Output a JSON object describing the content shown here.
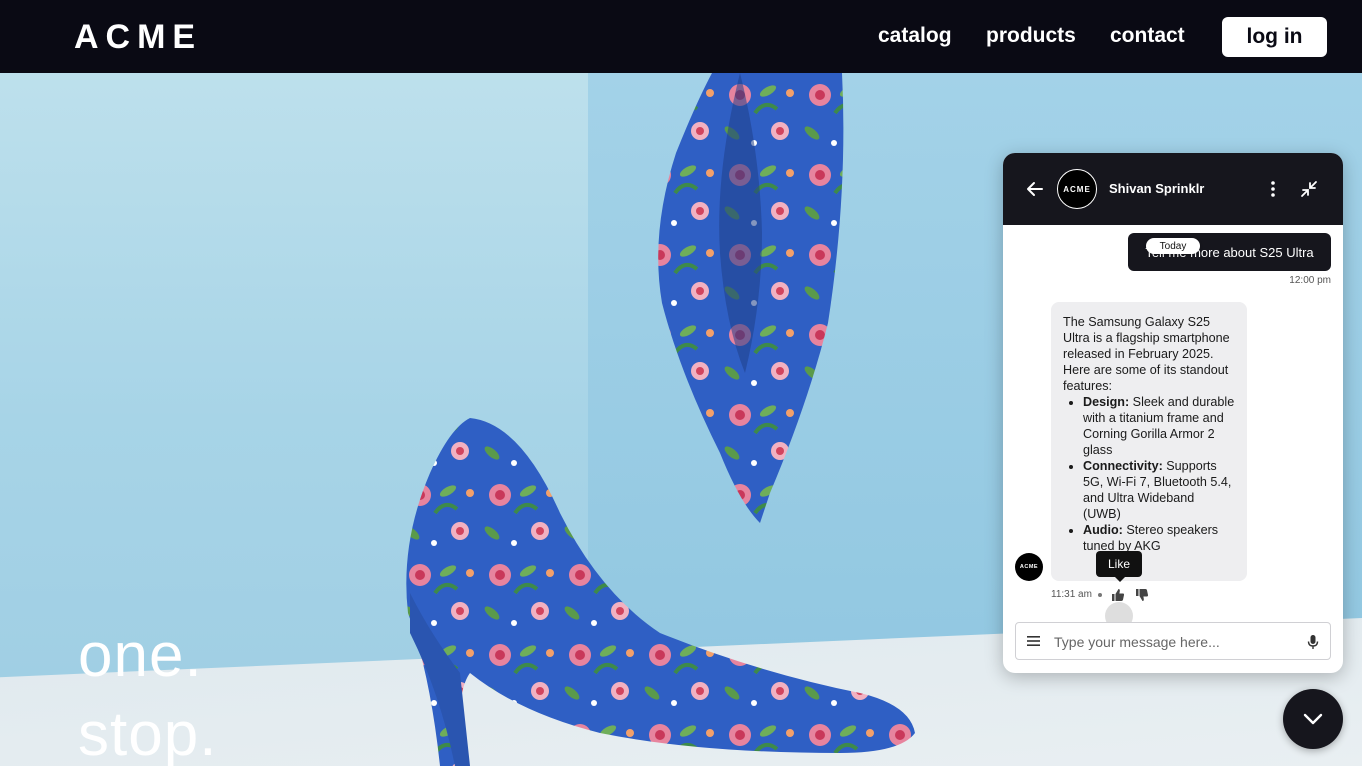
{
  "header": {
    "logo": "ACME",
    "nav": [
      "catalog",
      "products",
      "contact"
    ],
    "login_label": "log in"
  },
  "hero": {
    "tagline_line1": "one.",
    "tagline_line2": "stop."
  },
  "chat": {
    "agent_name": "Shivan Sprinklr",
    "avatar_text": "ACME",
    "today_label": "Today",
    "user_message": "Tell me more about S25 Ultra",
    "user_time": "12:00 pm",
    "bot_intro": "The Samsung Galaxy S25 Ultra is a flagship smartphone released in February 2025. Here are some of its standout features:",
    "bot_features": [
      {
        "title": "Design:",
        "text": " Sleek and durable with a titanium frame and Corning Gorilla Armor 2 glass"
      },
      {
        "title": "Connectivity:",
        "text": " Supports 5G, Wi-Fi 7, Bluetooth 5.4, and Ultra Wideband (UWB)"
      },
      {
        "title": "Audio:",
        "text": " Stereo speakers tuned by AKG"
      }
    ],
    "bot_time": "11:31 am",
    "tooltip": "Like",
    "input_placeholder": "Type your message here...",
    "icons": [
      "back-arrow-icon",
      "more-vertical-icon",
      "minimize-icon",
      "thumbs-up-icon",
      "thumbs-down-icon",
      "menu-icon",
      "microphone-icon",
      "chevron-down-icon"
    ]
  },
  "colors": {
    "header_bg": "#0a0a14",
    "chat_header_bg": "#16161d",
    "bot_bubble_bg": "#eeeef0"
  }
}
